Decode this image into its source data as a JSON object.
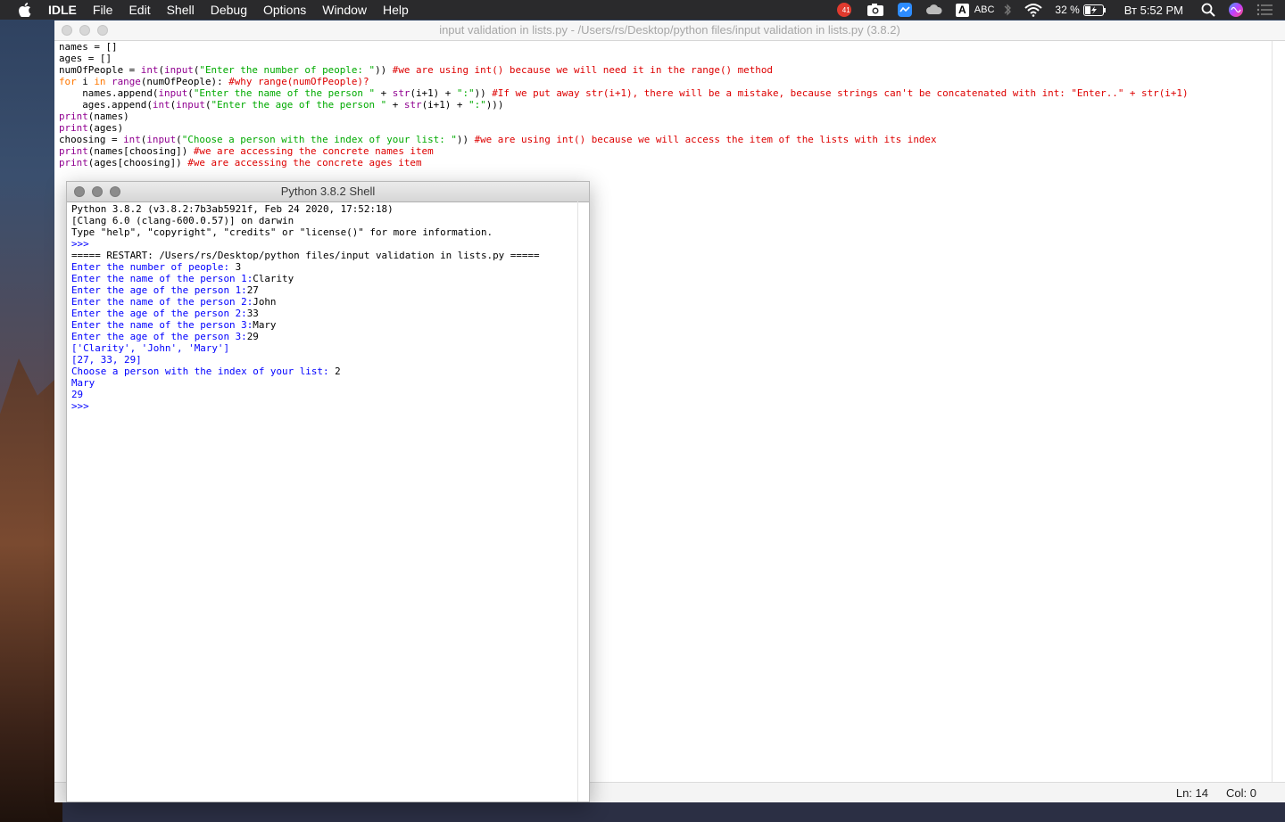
{
  "menubar": {
    "app": "IDLE",
    "items": [
      "File",
      "Edit",
      "Shell",
      "Debug",
      "Options",
      "Window",
      "Help"
    ],
    "status": {
      "badge_count": "41",
      "input_source": "ABC",
      "battery": "32 %",
      "clock": "Вт 5:52 PM"
    }
  },
  "editor": {
    "title": "input validation in lists.py - /Users/rs/Desktop/python files/input validation in lists.py (3.8.2)",
    "status_ln": "Ln: 14",
    "status_col": "Col: 0",
    "lines": [
      [
        {
          "t": "names = []",
          "c": "default"
        }
      ],
      [
        {
          "t": "ages = []",
          "c": "default"
        }
      ],
      [
        {
          "t": "numOfPeople = ",
          "c": "default"
        },
        {
          "t": "int",
          "c": "builtin"
        },
        {
          "t": "(",
          "c": "default"
        },
        {
          "t": "input",
          "c": "builtin"
        },
        {
          "t": "(",
          "c": "default"
        },
        {
          "t": "\"Enter the number of people: \"",
          "c": "string"
        },
        {
          "t": ")) ",
          "c": "default"
        },
        {
          "t": "#we are using int() because we will need it in the range() method",
          "c": "comment"
        }
      ],
      [
        {
          "t": "for",
          "c": "keyword"
        },
        {
          "t": " i ",
          "c": "default"
        },
        {
          "t": "in",
          "c": "keyword"
        },
        {
          "t": " ",
          "c": "default"
        },
        {
          "t": "range",
          "c": "builtin"
        },
        {
          "t": "(numOfPeople): ",
          "c": "default"
        },
        {
          "t": "#why range(numOfPeople)?",
          "c": "comment"
        }
      ],
      [
        {
          "t": "    names.append(",
          "c": "default"
        },
        {
          "t": "input",
          "c": "builtin"
        },
        {
          "t": "(",
          "c": "default"
        },
        {
          "t": "\"Enter the name of the person \"",
          "c": "string"
        },
        {
          "t": " + ",
          "c": "default"
        },
        {
          "t": "str",
          "c": "builtin"
        },
        {
          "t": "(i+1) + ",
          "c": "default"
        },
        {
          "t": "\":\"",
          "c": "string"
        },
        {
          "t": ")) ",
          "c": "default"
        },
        {
          "t": "#If we put away str(i+1), there will be a mistake, because strings can't be concatenated with int: \"Enter..\" + str(i+1)",
          "c": "comment"
        }
      ],
      [
        {
          "t": "    ages.append(",
          "c": "default"
        },
        {
          "t": "int",
          "c": "builtin"
        },
        {
          "t": "(",
          "c": "default"
        },
        {
          "t": "input",
          "c": "builtin"
        },
        {
          "t": "(",
          "c": "default"
        },
        {
          "t": "\"Enter the age of the person \"",
          "c": "string"
        },
        {
          "t": " + ",
          "c": "default"
        },
        {
          "t": "str",
          "c": "builtin"
        },
        {
          "t": "(i+1) + ",
          "c": "default"
        },
        {
          "t": "\":\"",
          "c": "string"
        },
        {
          "t": ")))",
          "c": "default"
        }
      ],
      [
        {
          "t": "print",
          "c": "builtin"
        },
        {
          "t": "(names)",
          "c": "default"
        }
      ],
      [
        {
          "t": "print",
          "c": "builtin"
        },
        {
          "t": "(ages)",
          "c": "default"
        }
      ],
      [
        {
          "t": "choosing = ",
          "c": "default"
        },
        {
          "t": "int",
          "c": "builtin"
        },
        {
          "t": "(",
          "c": "default"
        },
        {
          "t": "input",
          "c": "builtin"
        },
        {
          "t": "(",
          "c": "default"
        },
        {
          "t": "\"Choose a person with the index of your list: \"",
          "c": "string"
        },
        {
          "t": ")) ",
          "c": "default"
        },
        {
          "t": "#we are using int() because we will access the item of the lists with its index",
          "c": "comment"
        }
      ],
      [
        {
          "t": "print",
          "c": "builtin"
        },
        {
          "t": "(names[choosing]) ",
          "c": "default"
        },
        {
          "t": "#we are accessing the concrete names item",
          "c": "comment"
        }
      ],
      [
        {
          "t": "print",
          "c": "builtin"
        },
        {
          "t": "(ages[choosing]) ",
          "c": "default"
        },
        {
          "t": "#we are accessing the concrete ages item",
          "c": "comment"
        }
      ]
    ]
  },
  "shell": {
    "title": "Python 3.8.2 Shell",
    "lines": [
      [
        {
          "t": "Python 3.8.2 (v3.8.2:7b3ab5921f, Feb 24 2020, 17:52:18)",
          "c": "default"
        }
      ],
      [
        {
          "t": "[Clang 6.0 (clang-600.0.57)] on darwin",
          "c": "default"
        }
      ],
      [
        {
          "t": "Type \"help\", \"copyright\", \"credits\" or \"license()\" for more information.",
          "c": "default"
        }
      ],
      [
        {
          "t": ">>> ",
          "c": "prompt"
        }
      ],
      [
        {
          "t": "===== RESTART: /Users/rs/Desktop/python files/input validation in lists.py =====",
          "c": "default"
        }
      ],
      [
        {
          "t": "Enter the number of people: ",
          "c": "output"
        },
        {
          "t": "3",
          "c": "default"
        }
      ],
      [
        {
          "t": "Enter the name of the person 1:",
          "c": "output"
        },
        {
          "t": "Clarity",
          "c": "default"
        }
      ],
      [
        {
          "t": "Enter the age of the person 1:",
          "c": "output"
        },
        {
          "t": "27",
          "c": "default"
        }
      ],
      [
        {
          "t": "Enter the name of the person 2:",
          "c": "output"
        },
        {
          "t": "John",
          "c": "default"
        }
      ],
      [
        {
          "t": "Enter the age of the person 2:",
          "c": "output"
        },
        {
          "t": "33",
          "c": "default"
        }
      ],
      [
        {
          "t": "Enter the name of the person 3:",
          "c": "output"
        },
        {
          "t": "Mary",
          "c": "default"
        }
      ],
      [
        {
          "t": "Enter the age of the person 3:",
          "c": "output"
        },
        {
          "t": "29",
          "c": "default"
        }
      ],
      [
        {
          "t": "['Clarity', 'John', 'Mary']",
          "c": "output"
        }
      ],
      [
        {
          "t": "[27, 33, 29]",
          "c": "output"
        }
      ],
      [
        {
          "t": "Choose a person with the index of your list: ",
          "c": "output"
        },
        {
          "t": "2",
          "c": "default"
        }
      ],
      [
        {
          "t": "Mary",
          "c": "output"
        }
      ],
      [
        {
          "t": "29",
          "c": "output"
        }
      ],
      [
        {
          "t": ">>> ",
          "c": "prompt"
        }
      ]
    ]
  }
}
